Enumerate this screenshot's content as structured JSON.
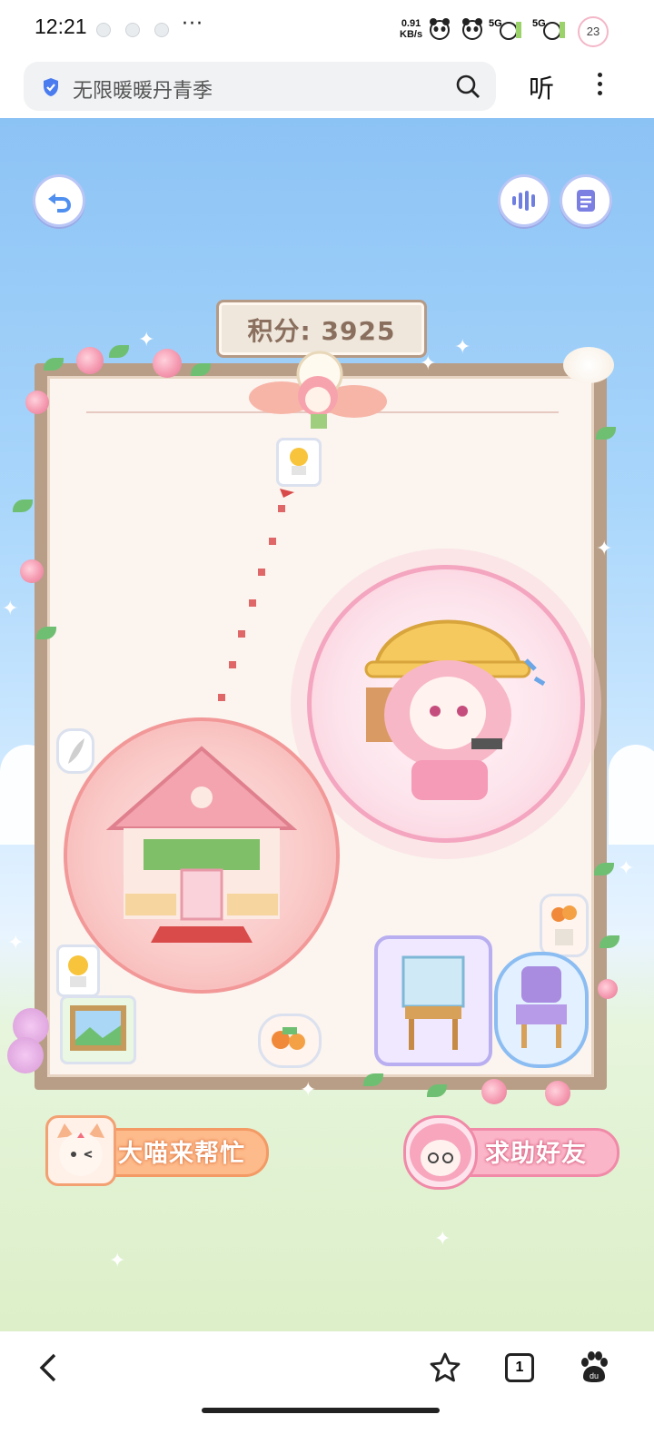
{
  "status_bar": {
    "time": "12:21",
    "more": "···",
    "net_speed_value": "0.91",
    "net_speed_unit": "KB/s",
    "signal_label_1": "5G",
    "signal_label_2": "5G",
    "battery": "23"
  },
  "browser": {
    "url_title": "无限暖暖丹青季",
    "listen_label": "听",
    "search_icon": "search-icon",
    "menu_icon": "kebab-icon"
  },
  "game": {
    "score_text": "积分: 3925",
    "back_icon": "undo-icon",
    "sound_icon": "sound-wave-icon",
    "notes_icon": "notes-icon",
    "help_cat_label": "大喵来帮忙",
    "help_friend_label": "求助好友"
  },
  "bottom_nav": {
    "tab_count": "1",
    "back_icon": "back-arrow-icon",
    "bookmark_icon": "star-icon",
    "baidu_icon": "baidu-paw-icon"
  }
}
